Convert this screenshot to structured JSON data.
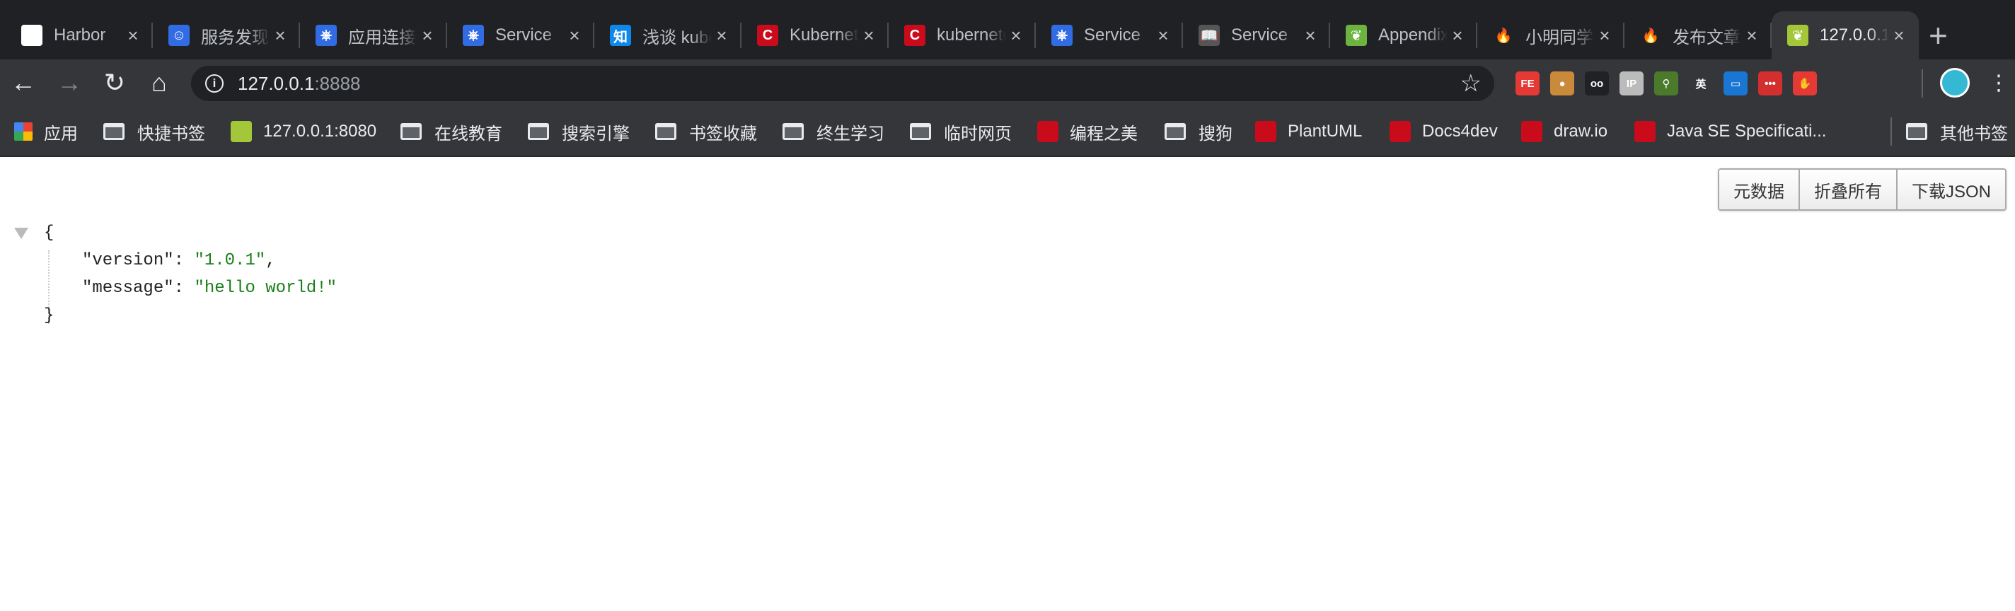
{
  "tabs": [
    {
      "title": "Harbor",
      "icon": "harbor-icon",
      "color": "#ffffff",
      "glyph": "⚓"
    },
    {
      "title": "服务发现",
      "icon": "avatar-icon",
      "color": "#326ce5",
      "glyph": "☺"
    },
    {
      "title": "应用连接",
      "icon": "kubernetes-icon",
      "color": "#326ce5",
      "glyph": "⎈"
    },
    {
      "title": "Service",
      "icon": "kubernetes-icon",
      "color": "#326ce5",
      "glyph": "⎈"
    },
    {
      "title": "浅谈 kube",
      "icon": "zhihu-icon",
      "color": "#0f88eb",
      "glyph": "知"
    },
    {
      "title": "Kubernetes",
      "icon": "csdn-icon",
      "color": "#c90b1b",
      "glyph": "C"
    },
    {
      "title": "kubernetes",
      "icon": "csdn-icon",
      "color": "#c90b1b",
      "glyph": "C"
    },
    {
      "title": "Service",
      "icon": "kubernetes-icon",
      "color": "#326ce5",
      "glyph": "⎈"
    },
    {
      "title": "Service",
      "icon": "book-icon",
      "color": "#555555",
      "glyph": "📖"
    },
    {
      "title": "Appendix",
      "icon": "spring-icon",
      "color": "#6db33f",
      "glyph": "❦"
    },
    {
      "title": "小明同学",
      "icon": "flame-icon",
      "color": "#202124",
      "glyph": "🔥"
    },
    {
      "title": "发布文章",
      "icon": "flame-icon",
      "color": "#202124",
      "glyph": "🔥"
    },
    {
      "title": "127.0.0.1",
      "icon": "spring-leaf-icon",
      "color": "#a4c639",
      "glyph": "❦"
    }
  ],
  "address": {
    "host": "127.0.0.1",
    "port": ":8888"
  },
  "extensions": [
    {
      "name": "fe-helper-icon",
      "color": "#e53935",
      "glyph": "FE"
    },
    {
      "name": "cookie-icon",
      "color": "#c98a3a",
      "glyph": "●"
    },
    {
      "name": "glasses-icon",
      "color": "#202124",
      "glyph": "oo"
    },
    {
      "name": "ip-icon",
      "color": "#bbbbbb",
      "glyph": "IP"
    },
    {
      "name": "magnifier-icon",
      "color": "#4a7a2a",
      "glyph": "⚲"
    },
    {
      "name": "translate-icon",
      "color": "#35363a",
      "glyph": "英"
    },
    {
      "name": "screen-icon",
      "color": "#1976d2",
      "glyph": "▭"
    },
    {
      "name": "lastpass-icon",
      "color": "#d32f2f",
      "glyph": "•••"
    },
    {
      "name": "adblock-icon",
      "color": "#e53935",
      "glyph": "✋"
    }
  ],
  "bookmarks": [
    {
      "label": "应用",
      "type": "apps"
    },
    {
      "label": "快捷书签",
      "type": "folder"
    },
    {
      "label": "127.0.0.1:8080",
      "type": "spring"
    },
    {
      "label": "在线教育",
      "type": "folder"
    },
    {
      "label": "搜索引擎",
      "type": "folder"
    },
    {
      "label": "书签收藏",
      "type": "folder"
    },
    {
      "label": "终生学习",
      "type": "folder"
    },
    {
      "label": "临时网页",
      "type": "folder"
    },
    {
      "label": "编程之美",
      "type": "site"
    },
    {
      "label": "搜狗",
      "type": "folder"
    },
    {
      "label": "PlantUML",
      "type": "site"
    },
    {
      "label": "Docs4dev",
      "type": "site"
    },
    {
      "label": "draw.io",
      "type": "site"
    },
    {
      "label": "Java SE Specificati...",
      "type": "site"
    },
    {
      "label": "其他书签",
      "type": "folder"
    }
  ],
  "viewer": {
    "buttons": {
      "meta": "元数据",
      "collapse": "折叠所有",
      "download": "下载JSON"
    },
    "json": {
      "open": "{",
      "close": "}",
      "entries": [
        {
          "key": "\"version\"",
          "value": "\"1.0.1\"",
          "comma": ","
        },
        {
          "key": "\"message\"",
          "value": "\"hello world!\"",
          "comma": ""
        }
      ]
    }
  }
}
